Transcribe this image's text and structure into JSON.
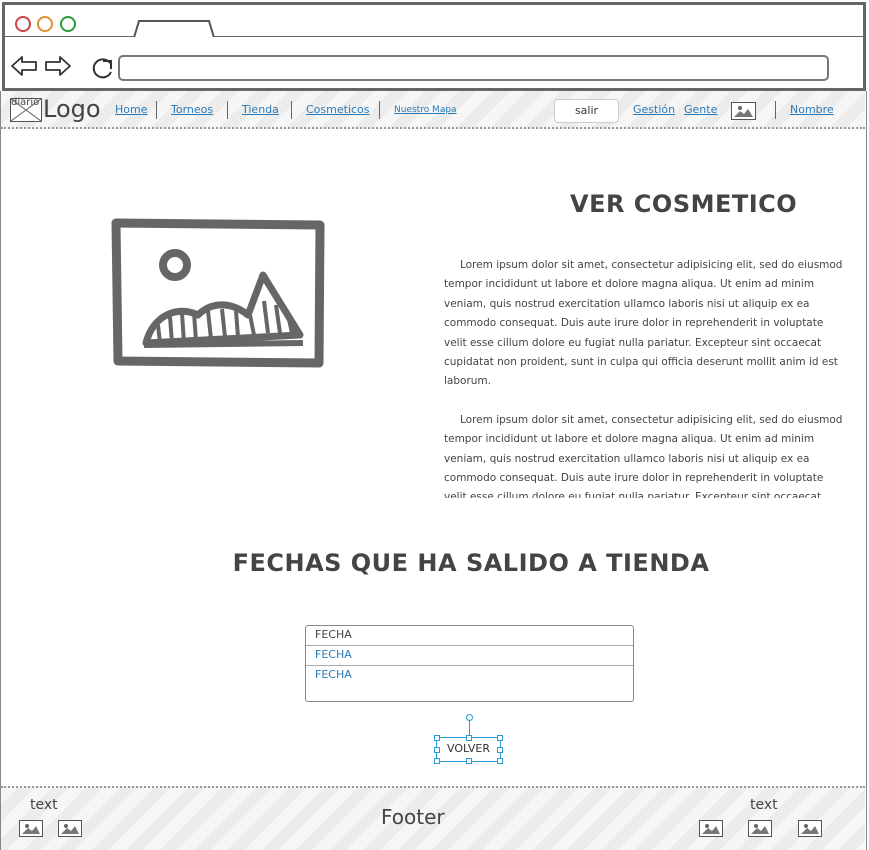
{
  "browser": {
    "tab_label": "",
    "address": ""
  },
  "header": {
    "logo_image_label": "diario",
    "logo": "Logo",
    "nav": [
      "Home",
      "Torneos",
      "Tienda",
      "Cosmeticos",
      "Nuestro Mapa"
    ],
    "salir": "salir",
    "gestion": "Gestión",
    "gente": "Gente",
    "nombre": "Nombre"
  },
  "main": {
    "title": "VER COSMETICO",
    "paragraphs": [
      "Lorem ipsum dolor sit amet, consectetur adipisicing elit, sed do eiusmod tempor incididunt ut labore et dolore magna aliqua. Ut enim ad minim veniam, quis nostrud exercitation ullamco laboris nisi ut aliquip ex ea commodo consequat. Duis aute irure dolor in reprehenderit in voluptate velit esse cillum dolore eu fugiat nulla pariatur. Excepteur sint occaecat cupidatat non proident, sunt in culpa qui officia deserunt mollit anim id est laborum.",
      "Lorem ipsum dolor sit amet, consectetur adipisicing elit, sed do eiusmod tempor incididunt ut labore et dolore magna aliqua. Ut enim ad minim veniam, quis nostrud exercitation ullamco laboris nisi ut aliquip ex ea commodo consequat. Duis aute irure dolor in reprehenderit in voluptate velit esse cillum dolore eu fugiat nulla pariatur. Excepteur sint occaecat cupidatat non proident, sunt in culpa qui officia deserunt mollit anim id est laborum."
    ],
    "dates_title": "FECHAS QUE HA SALIDO A TIENDA",
    "dates": [
      "FECHA",
      "FECHA",
      "FECHA"
    ],
    "back_button": "VOLVER"
  },
  "footer": {
    "left_text": "text",
    "title": "Footer",
    "right_text": "text"
  },
  "colors": {
    "link": "#2a7ab8",
    "selection": "#2a9ad8"
  }
}
